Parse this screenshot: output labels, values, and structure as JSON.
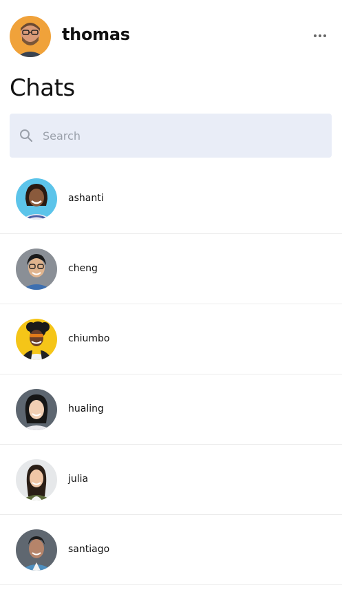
{
  "user": {
    "name": "thomas"
  },
  "page": {
    "title": "Chats"
  },
  "search": {
    "placeholder": "Search",
    "value": ""
  },
  "chats": [
    {
      "name": "ashanti"
    },
    {
      "name": "cheng"
    },
    {
      "name": "chiumbo"
    },
    {
      "name": "hualing"
    },
    {
      "name": "julia"
    },
    {
      "name": "santiago"
    }
  ],
  "icons": {
    "menu": "more-horizontal-icon",
    "search": "search-icon"
  },
  "colors": {
    "search_bg": "#e9edf7",
    "divider": "#ececec",
    "text": "#111111",
    "placeholder": "#9aa0aa"
  }
}
